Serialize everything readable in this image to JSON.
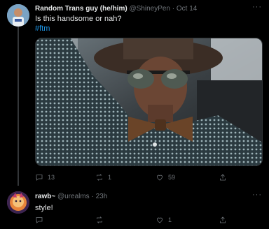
{
  "tweet": {
    "author_name": "Random Trans guy (he/him)",
    "handle_time": "@ShineyPen · Oct 14",
    "text": "Is this handsome or nah?",
    "hashtag": "#ftm",
    "media_description_icon": "photo",
    "actions": {
      "reply_count": "13",
      "retweet_count": "1",
      "like_count": "59",
      "share_label": ""
    }
  },
  "reply": {
    "author_name": "rawb~",
    "handle_time": "@urealms · 23h",
    "text": "style!",
    "actions": {
      "reply_count": "",
      "retweet_count": "",
      "like_count": "1",
      "share_label": ""
    }
  },
  "more_glyph": "···",
  "colors": {
    "background": "#000000",
    "text_primary": "#e7e9ea",
    "text_secondary": "#71767b",
    "link": "#1d9bf0",
    "divider": "#333639"
  }
}
